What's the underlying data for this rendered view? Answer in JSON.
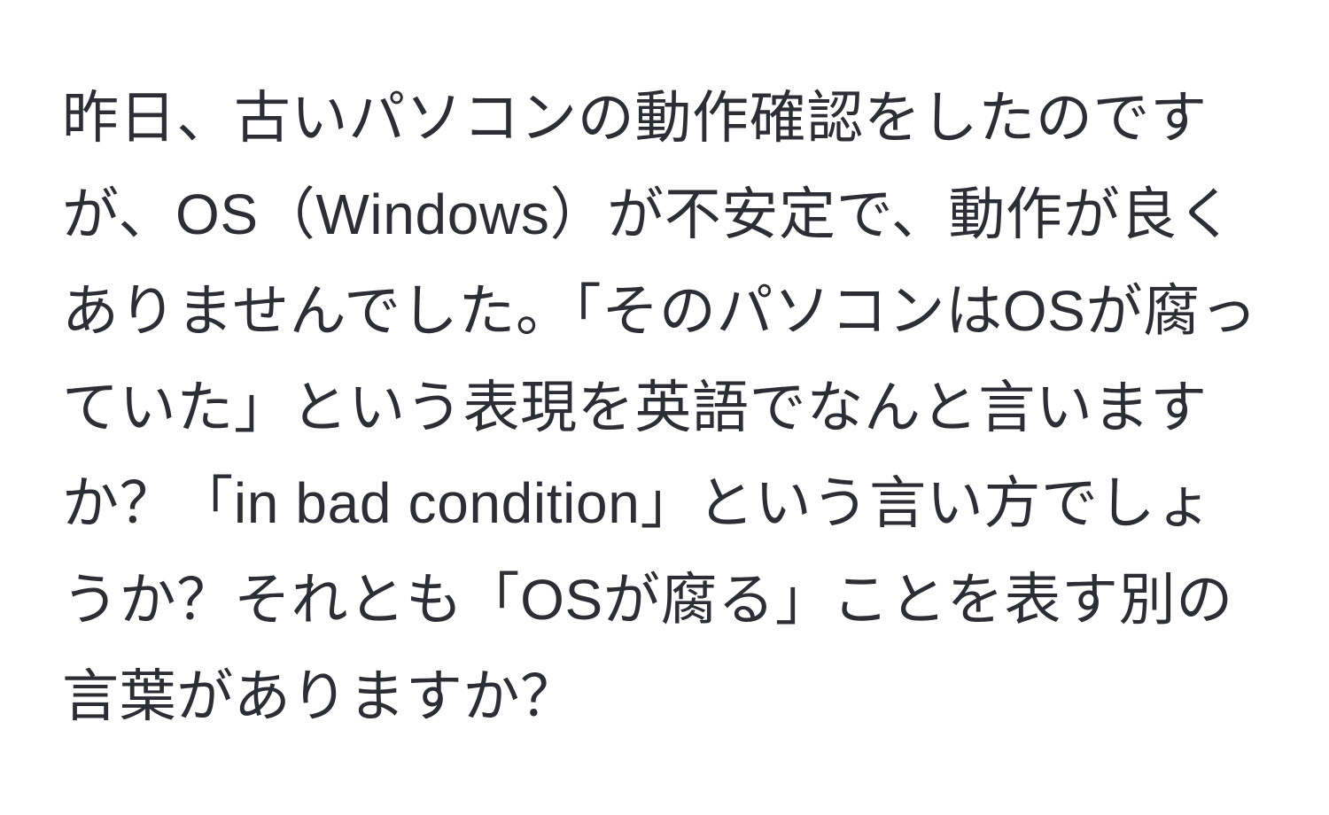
{
  "paragraph": {
    "text": "昨日、古いパソコンの動作確認をしたのですが、OS（Windows）が不安定で、動作が良くありませんでした。「そのパソコンはOSが腐っていた」という表現を英語でなんと言いますか？「in bad condition」という言い方でしょうか？それとも「OSが腐る」ことを表す別の言葉がありますか？"
  }
}
